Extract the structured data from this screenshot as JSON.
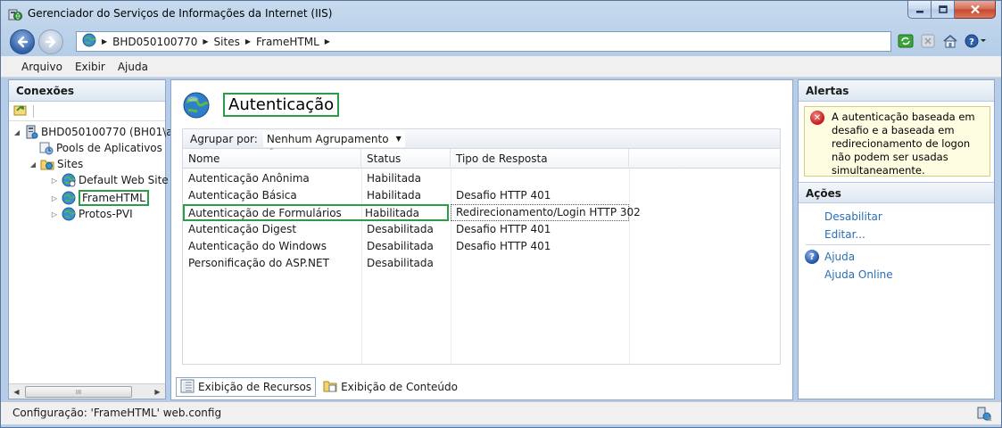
{
  "window": {
    "title": "Gerenciador do Serviços de Informações da Internet (IIS)"
  },
  "address_bar": {
    "crumbs": [
      "BHD050100770",
      "Sites",
      "FrameHTML"
    ]
  },
  "menu": {
    "items": [
      "Arquivo",
      "Exibir",
      "Ajuda"
    ]
  },
  "connections": {
    "header": "Conexões",
    "tree": {
      "server": "BHD050100770 (BH01\\ale",
      "pools": "Pools de Aplicativos",
      "sites": "Sites",
      "default_site": "Default Web Site",
      "framehtml": "FrameHTML",
      "protos": "Protos-PVI"
    },
    "scroll_thumb": "III"
  },
  "main": {
    "title": "Autenticação",
    "group_label": "Agrupar por:",
    "group_value": "Nenhum Agrupamento",
    "columns": [
      "Nome",
      "Status",
      "Tipo de Resposta"
    ],
    "rows": [
      {
        "name": "Autenticação Anônima",
        "status": "Habilitada",
        "response": ""
      },
      {
        "name": "Autenticação Básica",
        "status": "Habilitada",
        "response": "Desafio HTTP 401"
      },
      {
        "name": "Autenticação de Formulários",
        "status": "Habilitada",
        "response": "Redirecionamento/Login HTTP 302"
      },
      {
        "name": "Autenticação Digest",
        "status": "Desabilitada",
        "response": "Desafio HTTP 401"
      },
      {
        "name": "Autenticação do Windows",
        "status": "Desabilitada",
        "response": "Desafio HTTP 401"
      },
      {
        "name": "Personificação do ASP.NET",
        "status": "Desabilitada",
        "response": ""
      }
    ],
    "tabs": {
      "features": "Exibição de Recursos",
      "content": "Exibição de Conteúdo"
    }
  },
  "right": {
    "alerts_header": "Alertas",
    "alert_text": "A autenticação baseada em desafio e a baseada em redirecionamento de logon não podem ser usadas simultaneamente.",
    "actions_header": "Ações",
    "disable": "Desabilitar",
    "edit": "Editar...",
    "help": "Ajuda",
    "help_online": "Ajuda Online"
  },
  "status": {
    "text": "Configuração: 'FrameHTML' web.config"
  },
  "colors": {
    "highlight_border": "#2a9d46",
    "link": "#2a6fb5",
    "alert_bg": "#fffde1"
  }
}
